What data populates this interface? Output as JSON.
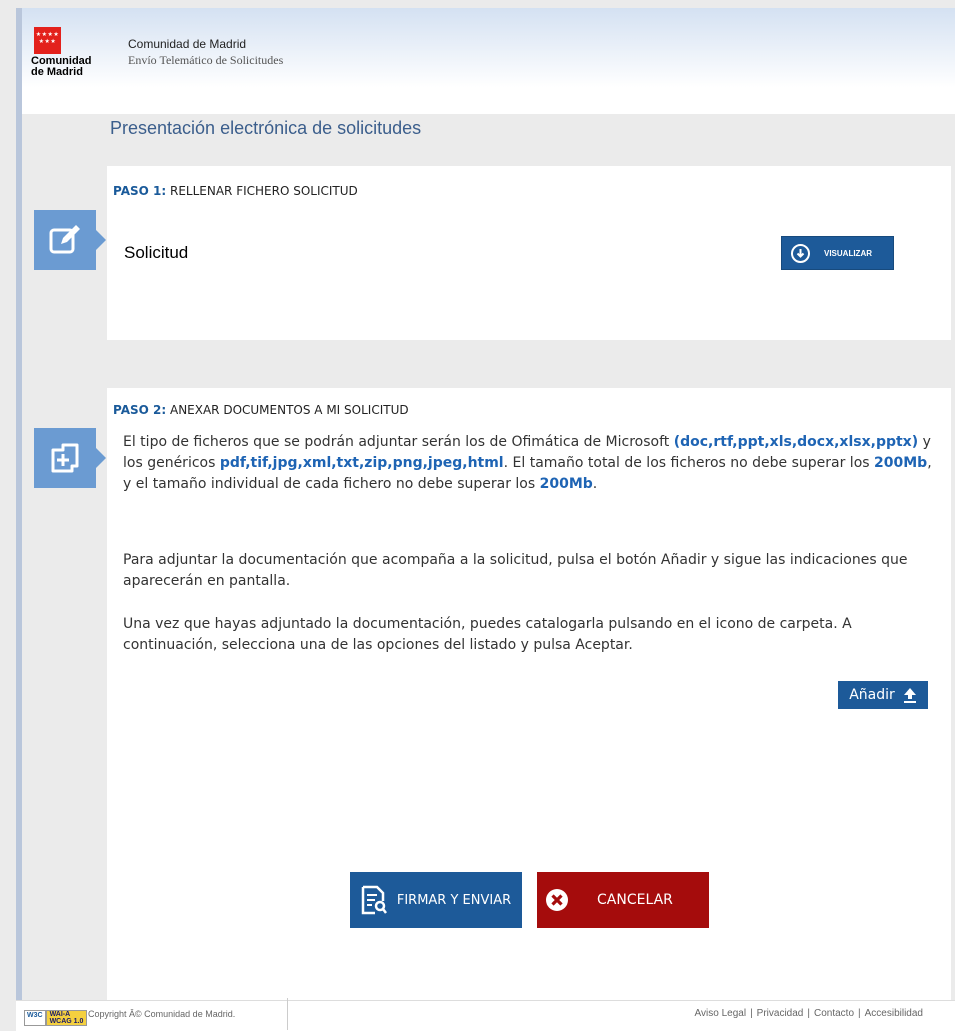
{
  "header": {
    "logo_stars": "★★★★\n★★★",
    "logo_text_line1": "Comunidad",
    "logo_text_line2": "de Madrid",
    "line1": "Comunidad de Madrid",
    "line2": "Envío Telemático de Solicitudes"
  },
  "page_title": "Presentación electrónica de solicitudes",
  "step1": {
    "prefix": "PASO 1:",
    "title": "RELLENAR FICHERO SOLICITUD",
    "icon": "edit-document-icon",
    "item_label": "Solicitud",
    "view_button": "VISUALIZAR"
  },
  "step2": {
    "prefix": "PASO 2:",
    "title": "ANEXAR DOCUMENTOS A MI SOLICITUD",
    "icon": "add-document-icon",
    "p1_a": "El tipo de ficheros que se podrán adjuntar serán los de Ofimática de Microsoft ",
    "p1_b": "(doc,rtf,ppt,xls,docx,xlsx,pptx)",
    "p1_c": " y los genéricos ",
    "p1_d": "pdf,tif,jpg,xml,txt,zip,png,jpeg,html",
    "p1_e": ". El tamaño total de los ficheros no debe superar los ",
    "p1_f": "200Mb",
    "p1_g": ", y el tamaño individual de cada fichero no debe superar los ",
    "p1_h": "200Mb",
    "p1_i": ".",
    "p2": "Para adjuntar la documentación que acompaña a la solicitud, pulsa el botón Añadir y sigue las indicaciones que aparecerán en pantalla.",
    "p3": "Una vez que hayas adjuntado la documentación, puedes catalogarla pulsando en el icono de carpeta. A continuación, selecciona una de las opciones del listado y pulsa Aceptar.",
    "add_button": "Añadir"
  },
  "actions": {
    "sign_send": "FIRMAR Y ENVIAR",
    "cancel": "CANCELAR"
  },
  "footer": {
    "w3c": "W3C",
    "wai_line1": "WAI-A",
    "wai_line2": "WCAG 1.0",
    "copyright": "Copyright Â© Comunidad de Madrid.",
    "links": [
      "Aviso Legal",
      "Privacidad",
      "Contacto",
      "Accesibilidad"
    ]
  },
  "colors": {
    "primary_blue": "#1d5a99",
    "cancel_red": "#a50c0c",
    "icon_blue": "#6b9bd2",
    "highlight_blue": "#1e64b4"
  }
}
